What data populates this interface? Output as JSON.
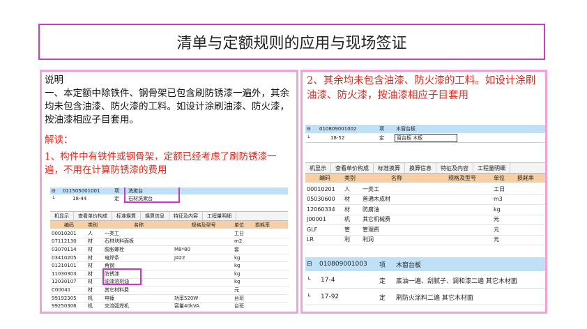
{
  "title": "清单与定额规则的应用与现场签证",
  "left": {
    "heading": "说明",
    "para": "一、本定额中除铁件、钢骨架已包含刷防锈漆一遍外，其余均未包含油漆、防火漆的工料。如设计涂刷油漆、防火漆，按油漆相应子目套用。",
    "jiedu": "解读：",
    "point1": "1、构件中有铁件或钢骨架，定额已经考虑了刷防锈漆一遍，不用在计算防锈漆的费用",
    "shot": {
      "top_code": "011505001001",
      "top_type": "项",
      "top_name": "洗漱台",
      "sub_code": "18-44",
      "sub_type": "定",
      "sub_name": "石材洗漱台",
      "tabs": [
        "机显示",
        "查看单价构成",
        "标准换算",
        "换算信息",
        "特征及内容",
        "工程量明细"
      ],
      "headers": [
        "编码",
        "类别",
        "名称",
        "规格及型号",
        "单位",
        "损耗率"
      ],
      "rows": [
        [
          "00010201",
          "人",
          "一类工",
          "",
          "工日",
          ""
        ],
        [
          "07112130",
          "材",
          "石材块料面板",
          "",
          "m2",
          ""
        ],
        [
          "03070114",
          "材",
          "膨胀螺栓",
          "M8*80",
          "套",
          ""
        ],
        [
          "03410205",
          "材",
          "电焊条",
          "J422",
          "kg",
          ""
        ],
        [
          "01210101",
          "材",
          "角钢",
          "",
          "kg",
          ""
        ],
        [
          "11030303",
          "材",
          "防锈漆",
          "",
          "kg",
          ""
        ],
        [
          "12030107",
          "材",
          "油漆溶剂油",
          "",
          "kg",
          ""
        ],
        [
          "C00041",
          "材",
          "其它材料费",
          "",
          "元",
          ""
        ],
        [
          "99192305",
          "机",
          "电锤",
          "功率520W",
          "台班",
          ""
        ],
        [
          "99250306",
          "机",
          "交流弧焊机",
          "容量40kVA",
          "台班",
          ""
        ]
      ]
    }
  },
  "right": {
    "point2": "2、其余均未包含油漆、防火漆的工料。如设计涂刷油漆、防火漆，按油漆相应子目套用",
    "shot1": {
      "top_code": "010809001002",
      "top_type": "项",
      "top_name": "木窗台板",
      "sub_code": "18-52",
      "sub_type": "定",
      "sub_name": "窗台板 木板",
      "tabs": [
        "机显示",
        "查看单价构成",
        "标准换算",
        "换算信息",
        "特征及内容",
        "工程量明细"
      ],
      "headers": [
        "编码",
        "类别",
        "名称",
        "规格及型号",
        "单位",
        "损耗率"
      ],
      "rows": [
        [
          "00010201",
          "人",
          "一类工",
          "",
          "工日",
          ""
        ],
        [
          "05030600",
          "材",
          "普通木成材",
          "",
          "m3",
          ""
        ],
        [
          "12060334",
          "材",
          "防腐油",
          "",
          "kg",
          ""
        ],
        [
          "J00001",
          "机",
          "其它机械费",
          "",
          "元",
          ""
        ],
        [
          "GLF",
          "管",
          "管理费",
          "",
          "元",
          ""
        ],
        [
          "LR",
          "利",
          "利润",
          "",
          "元",
          ""
        ]
      ]
    },
    "shot2": {
      "top_code": "010809001003",
      "top_type": "项",
      "top_name": "木窗台板",
      "rows": [
        [
          "17-4",
          "定",
          "底油一遍、刮腻子、调和漆二遍 其它木材面"
        ],
        [
          "17-92",
          "定",
          "刷防火涂料二遍 其它木材面"
        ]
      ]
    }
  }
}
